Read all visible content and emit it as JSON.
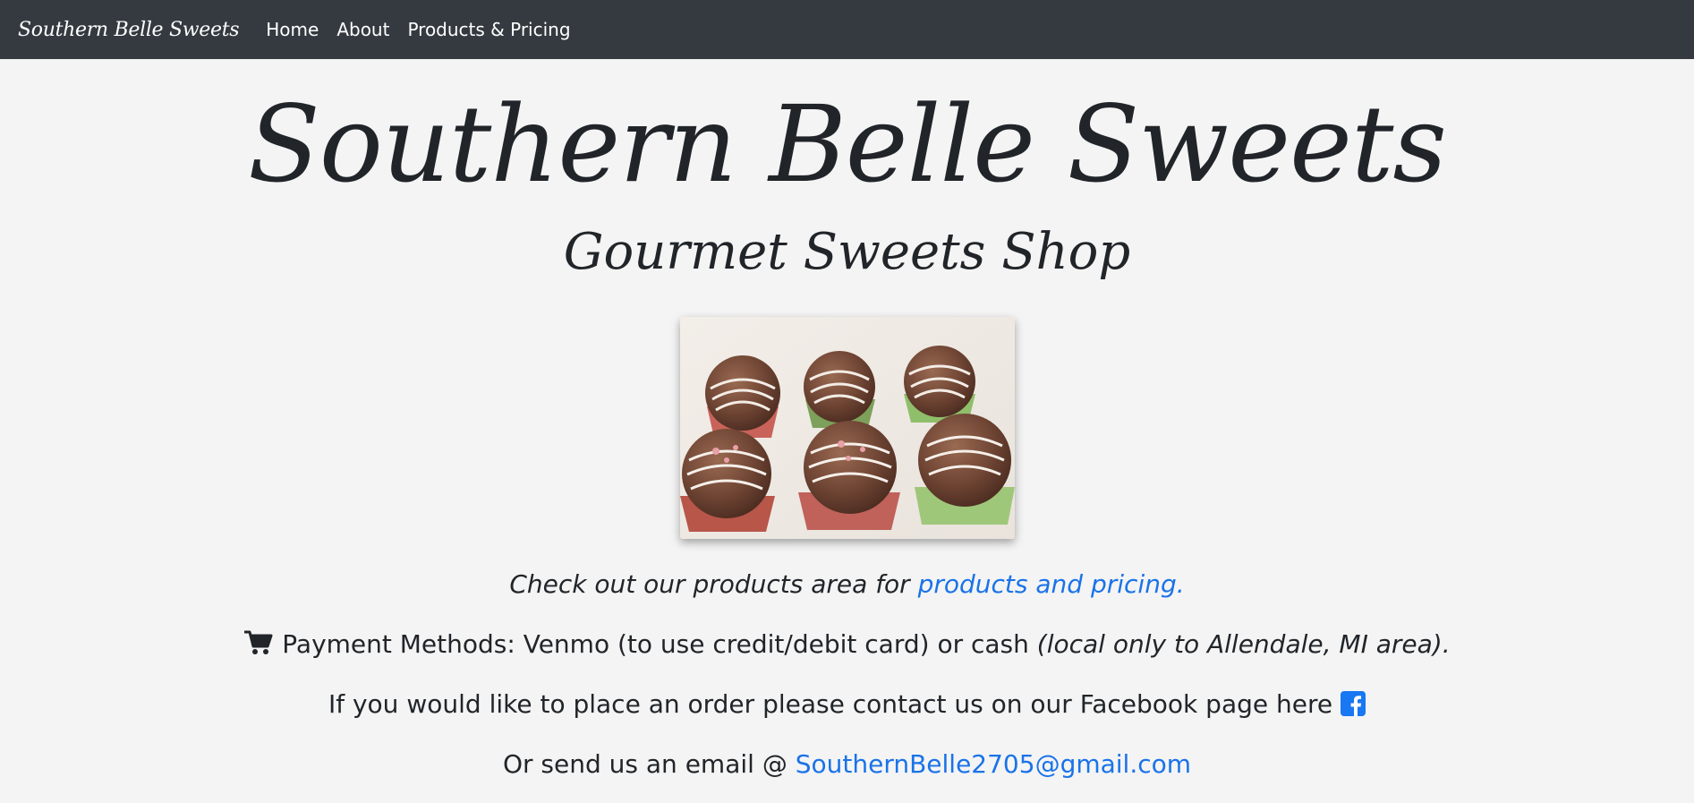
{
  "nav": {
    "brand": "Southern Belle Sweets",
    "links": [
      "Home",
      "About",
      "Products & Pricing"
    ]
  },
  "hero": {
    "title": "Southern Belle Sweets",
    "subtitle": "Gourmet Sweets Shop"
  },
  "content": {
    "products_prefix": "Check out our products area for ",
    "products_link": "products and pricing.",
    "payment_text": " Payment Methods: Venmo (to use credit/debit card) or cash ",
    "payment_note": "(local only to Allendale, MI area).",
    "order_text": "If you would like to place an order please contact us on our Facebook page here ",
    "email_prefix": "Or send us an email @ ",
    "email": "SouthernBelle2705@gmail.com"
  },
  "icons": {
    "cart": "shopping-cart-icon",
    "facebook": "facebook-square-icon"
  },
  "colors": {
    "navbar": "#343a40",
    "background": "#f4f4f4",
    "link": "#1a73e8",
    "facebook": "#1877f2"
  }
}
